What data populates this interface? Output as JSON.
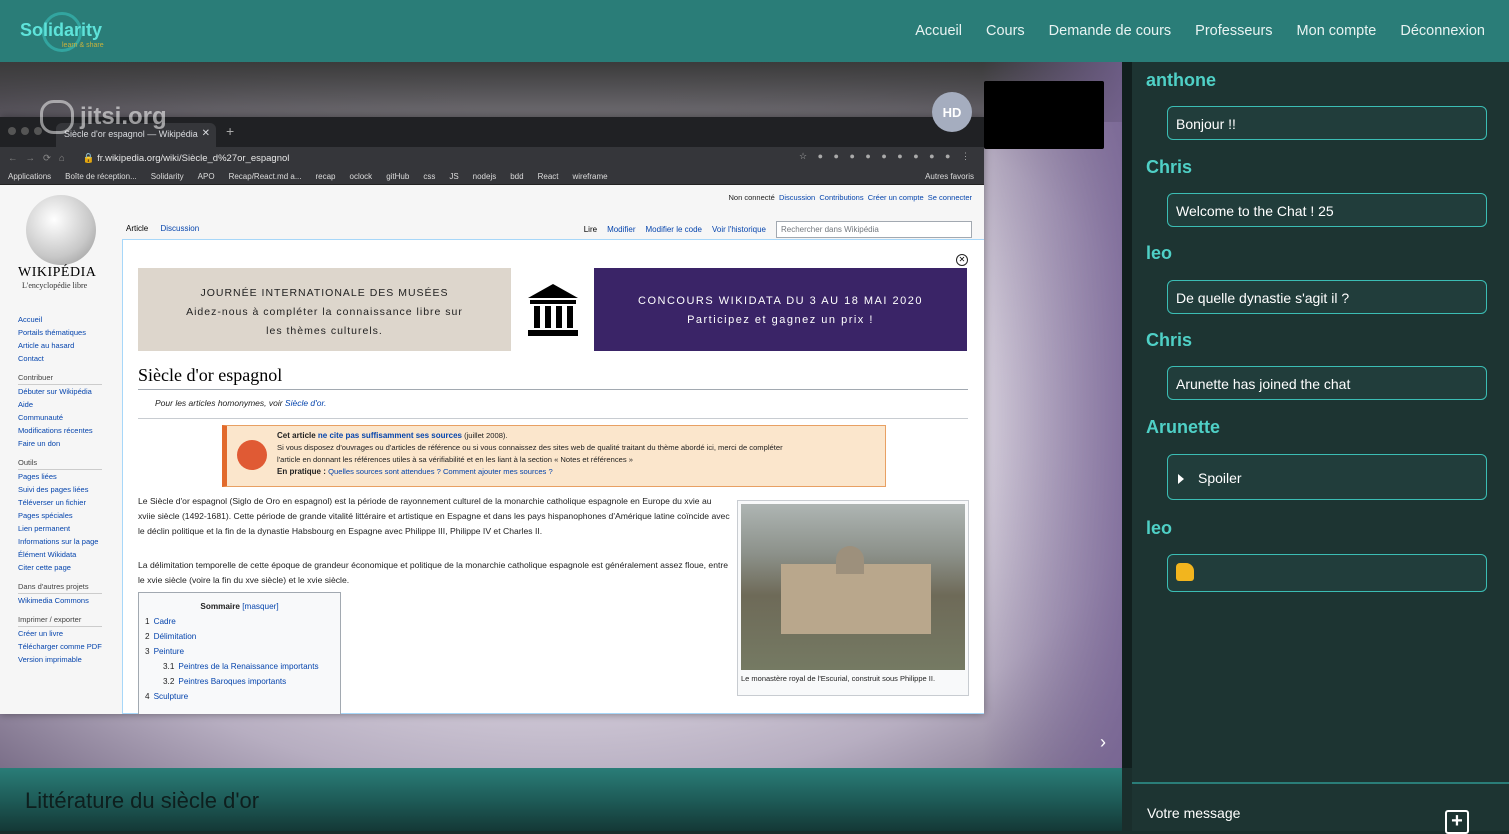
{
  "navbar": {
    "logo_text": "Solidarity",
    "logo_sub": "learn & share",
    "links": [
      "Accueil",
      "Cours",
      "Demande de cours",
      "Professeurs",
      "Mon compte",
      "Déconnexion"
    ]
  },
  "video": {
    "watermark": "jitsi.org",
    "avatar_initials": "HD"
  },
  "browser": {
    "tab_title": "Siècle d'or espagnol — Wikipédia",
    "url": "fr.wikipedia.org/wiki/Siècle_d%27or_espagnol",
    "bookmarks": [
      "Applications",
      "Boîte de réception...",
      "Solidarity",
      "APO",
      "Recap/React.md a...",
      "recap",
      "oclock",
      "gitHub",
      "css",
      "JS",
      "nodejs",
      "bdd",
      "React",
      "wireframe"
    ],
    "bookmarks_right": "Autres favoris"
  },
  "wiki": {
    "wordmark": "WIKIPÉDIA",
    "tagline": "L'encyclopédie libre",
    "nav": [
      "Accueil",
      "Portails thématiques",
      "Article au hasard",
      "Contact"
    ],
    "contrib_heading": "Contribuer",
    "contrib": [
      "Débuter sur Wikipédia",
      "Aide",
      "Communauté",
      "Modifications récentes",
      "Faire un don"
    ],
    "tools_heading": "Outils",
    "tools": [
      "Pages liées",
      "Suivi des pages liées",
      "Téléverser un fichier",
      "Pages spéciales",
      "Lien permanent",
      "Informations sur la page",
      "Élément Wikidata",
      "Citer cette page"
    ],
    "other_heading": "Dans d'autres projets",
    "other": [
      "Wikimedia Commons"
    ],
    "print_heading": "Imprimer / exporter",
    "print": [
      "Créer un livre",
      "Télécharger comme PDF",
      "Version imprimable"
    ],
    "top_links": [
      "Non connecté",
      "Discussion",
      "Contributions",
      "Créer un compte",
      "Se connecter"
    ],
    "tab_article": "Article",
    "tab_discussion": "Discussion",
    "actions": [
      "Lire",
      "Modifier",
      "Modifier le code",
      "Voir l'historique"
    ],
    "search_placeholder": "Rechercher dans Wikipédia",
    "banner1_line1": "JOURNÉE INTERNATIONALE DES MUSÉES",
    "banner1_line2": "Aidez-nous à compléter la connaissance libre sur",
    "banner1_line3": "les thèmes culturels.",
    "banner2_line1": "CONCOURS WIKIDATA DU 3 AU 18 MAI 2020",
    "banner2_line2": "Participez et gagnez un prix !",
    "title": "Siècle d'or espagnol",
    "homonym_prefix": "Pour les articles homonymes, voir ",
    "homonym_link": "Siècle d'or.",
    "warn_title_a": "Cet article ",
    "warn_title_b": "ne cite pas suffisamment ses sources",
    "warn_title_c": " (juillet 2008).",
    "warn_line1": "Si vous disposez d'ouvrages ou d'articles de référence ou si vous connaissez des sites web de qualité traitant du thème abordé ici, merci de compléter",
    "warn_line2": "l'article en donnant les références utiles à sa vérifiabilité et en les liant à la section « Notes et références »",
    "warn_practice": "En pratique : ",
    "warn_practice_link": "Quelles sources sont attendues ? Comment ajouter mes sources ?",
    "para1": "Le Siècle d'or espagnol (Siglo de Oro en espagnol) est la période de rayonnement culturel de la monarchie catholique espagnole en Europe du xvie au xviie siècle (1492-1681). Cette période de grande vitalité littéraire et artistique en Espagne et dans les pays hispanophones d'Amérique latine coïncide avec le déclin politique et la fin de la dynastie Habsbourg en Espagne avec Philippe III, Philippe IV et Charles II.",
    "para2": "La délimitation temporelle de cette époque de grandeur économique et politique de la monarchie catholique espagnole est généralement assez floue, entre le xvie siècle (voire la fin du xve siècle) et le xvie siècle.",
    "caption": "Le monastère royal de l'Escurial, construit sous Philippe II.",
    "toc_title": "Sommaire",
    "toc_hide": "[masquer]",
    "toc": [
      {
        "n": "1",
        "label": "Cadre"
      },
      {
        "n": "2",
        "label": "Délimitation"
      },
      {
        "n": "3",
        "label": "Peinture"
      },
      {
        "n": "3.1",
        "label": "Peintres de la Renaissance importants"
      },
      {
        "n": "3.2",
        "label": "Peintres Baroques importants"
      },
      {
        "n": "4",
        "label": "Sculpture"
      }
    ]
  },
  "course_title": "Littérature du siècle d'or",
  "chat": {
    "messages": [
      {
        "user": "anthone",
        "text": "Bonjour !!"
      },
      {
        "user": "Chris",
        "text": "Welcome to the Chat ! 25"
      },
      {
        "user": "leo",
        "text": "De quelle dynastie s'agit il ?"
      },
      {
        "user": "Chris",
        "text": "Arunette has joined the chat"
      },
      {
        "user": "Arunette",
        "text": "Spoiler"
      },
      {
        "user": "leo",
        "text": "👍"
      }
    ],
    "input_placeholder": "Votre message"
  },
  "colors": {
    "navbar": "#2a7d78",
    "accent": "#4fd0c6",
    "chat_bg": "#1d3432"
  }
}
